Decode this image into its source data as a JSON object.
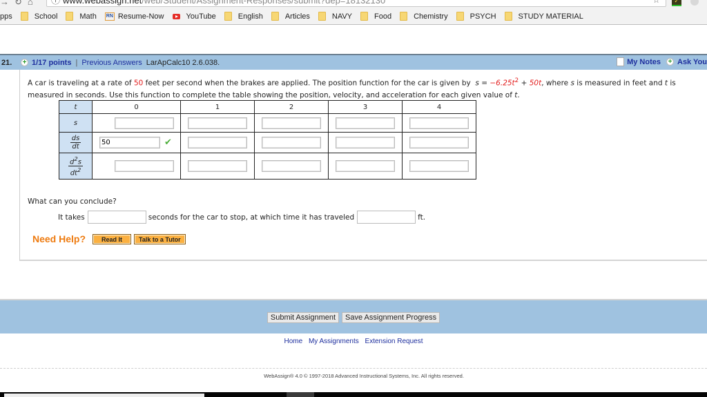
{
  "browser": {
    "url_host": "www.webassign.net",
    "url_path": "/web/Student/Assignment-Responses/submit?dep=18132130",
    "bookmarks": [
      {
        "label": "pps",
        "icon": "none"
      },
      {
        "label": "School",
        "icon": "folder-icon"
      },
      {
        "label": "Math",
        "icon": "folder-icon"
      },
      {
        "label": "Resume-Now",
        "icon": "resume-now-icon"
      },
      {
        "label": "YouTube",
        "icon": "youtube-icon"
      },
      {
        "label": "English",
        "icon": "folder-icon"
      },
      {
        "label": "Articles",
        "icon": "folder-icon"
      },
      {
        "label": "NAVY",
        "icon": "folder-icon"
      },
      {
        "label": "Food",
        "icon": "folder-icon"
      },
      {
        "label": "Chemistry",
        "icon": "folder-icon"
      },
      {
        "label": "PSYCH",
        "icon": "folder-icon"
      },
      {
        "label": "STUDY MATERIAL",
        "icon": "folder-icon"
      }
    ]
  },
  "question": {
    "number": "21.",
    "points": "1/17 points",
    "separator": "|",
    "previous_answers": "Previous Answers",
    "code": "LarApCalc10 2.6.038.",
    "my_notes": "My Notes",
    "ask_your": "Ask You",
    "prompt": {
      "p1": "A car is traveling at a rate of ",
      "rate": "50",
      "p2": " feet per second when the brakes are applied. The position function for the car is given by ",
      "s_eq": "s = ",
      "coef": "−6.25t",
      "sq": "2",
      "plus": " + ",
      "lin": "50t",
      "p3": ",  where ",
      "s": "s",
      "p4": " is measured in feet and ",
      "t": "t",
      "p5": " is measured in seconds. Use this function to complete the table showing the position, velocity, and acceleration for each given value of ",
      "t2": "t",
      "p6": "."
    },
    "table": {
      "header_label": "t",
      "t_values": [
        "0",
        "1",
        "2",
        "3",
        "4"
      ],
      "row_s_label": "s",
      "row_ds": {
        "num": "ds",
        "den": "dt"
      },
      "row_d2s": {
        "num": "d",
        "num_sup": "2",
        "num_s": "s",
        "den": "dt",
        "den_sup": "2"
      },
      "s_values": [
        "",
        "",
        "",
        "",
        ""
      ],
      "ds_values": [
        "50",
        "",
        "",
        "",
        ""
      ],
      "d2s_values": [
        "",
        "",
        "",
        "",
        ""
      ],
      "ds_0_status": "correct"
    },
    "conclude_label": "What can you conclude?",
    "takes_prefix": "It takes",
    "takes_middle": "seconds for the car to stop, at which time it has traveled",
    "takes_suffix": "ft.",
    "seconds_value": "",
    "distance_value": "",
    "need_help": "Need Help?",
    "read_it": "Read It",
    "talk_tutor": "Talk to a Tutor"
  },
  "footer": {
    "submit": "Submit Assignment",
    "save": "Save Assignment Progress",
    "links": [
      "Home",
      "My Assignments",
      "Extension Request"
    ],
    "copyright": "WebAssign® 4.0 © 1997-2018 Advanced Instructional Systems, Inc. All rights reserved."
  }
}
